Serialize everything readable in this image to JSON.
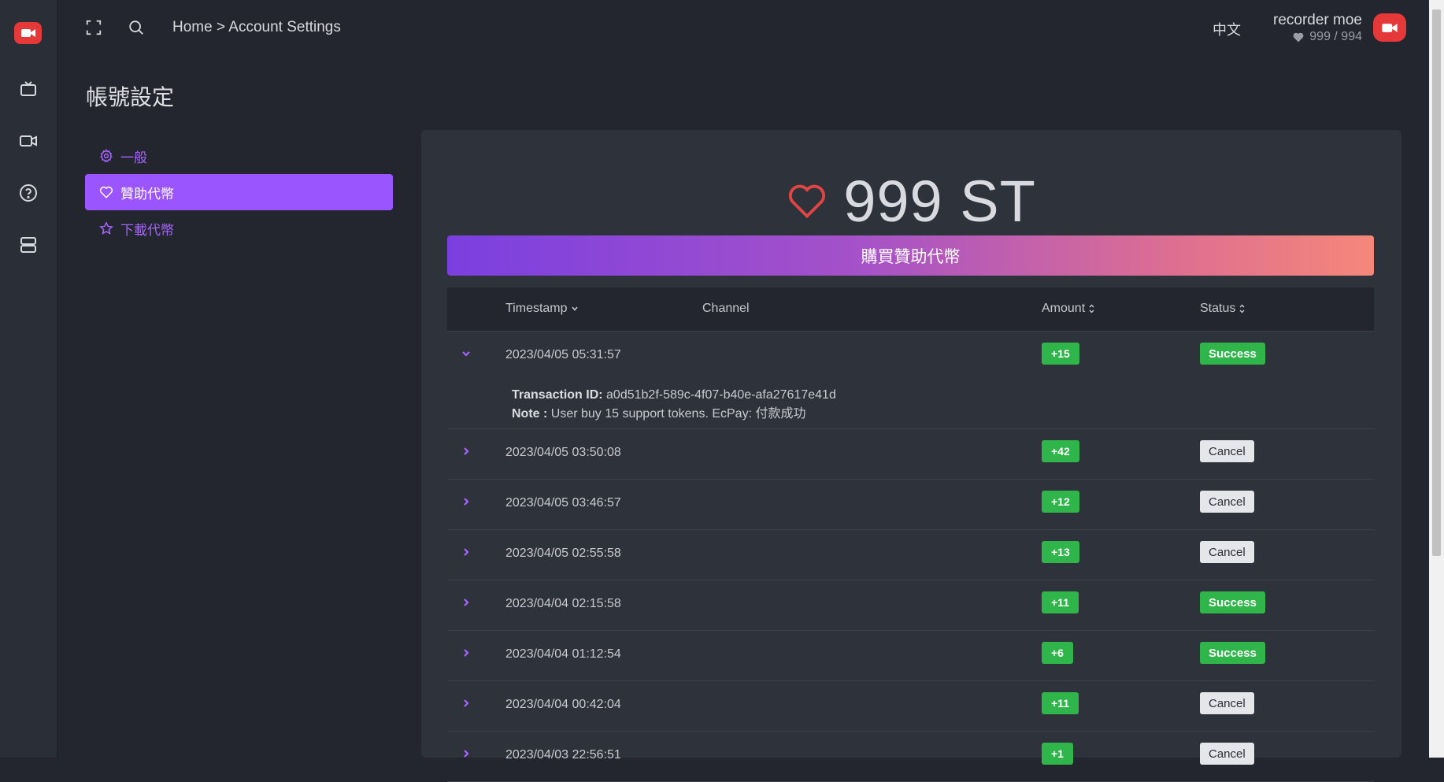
{
  "topbar": {
    "breadcrumb": "Home > Account Settings",
    "language": "中文",
    "user_name": "recorder moe",
    "user_tokens": "999 / 994"
  },
  "page": {
    "title": "帳號設定"
  },
  "side_menu": {
    "items": [
      {
        "label": "一般",
        "icon": "gear-icon"
      },
      {
        "label": "贊助代幣",
        "icon": "heart-icon",
        "active": true
      },
      {
        "label": "下載代幣",
        "icon": "star-icon"
      }
    ]
  },
  "balance": {
    "amount": "999 ST"
  },
  "buy_button": {
    "label": "購買贊助代幣"
  },
  "table": {
    "columns": [
      "Timestamp",
      "Channel",
      "Amount",
      "Status"
    ],
    "rows": [
      {
        "timestamp": "2023/04/05 05:31:57",
        "amount": "+15",
        "status": "Success",
        "expanded": true,
        "detail": {
          "txid_label": "Transaction ID:",
          "txid": "a0d51b2f-589c-4f07-b40e-afa27617e41d",
          "note_label": "Note :",
          "note": "User buy 15 support tokens. EcPay: 付款成功"
        }
      },
      {
        "timestamp": "2023/04/05 03:50:08",
        "amount": "+42",
        "status": "Cancel"
      },
      {
        "timestamp": "2023/04/05 03:46:57",
        "amount": "+12",
        "status": "Cancel"
      },
      {
        "timestamp": "2023/04/05 02:55:58",
        "amount": "+13",
        "status": "Cancel"
      },
      {
        "timestamp": "2023/04/04 02:15:58",
        "amount": "+11",
        "status": "Success"
      },
      {
        "timestamp": "2023/04/04 01:12:54",
        "amount": "+6",
        "status": "Success"
      },
      {
        "timestamp": "2023/04/04 00:42:04",
        "amount": "+11",
        "status": "Cancel"
      },
      {
        "timestamp": "2023/04/03 22:56:51",
        "amount": "+1",
        "status": "Cancel"
      }
    ]
  },
  "colors": {
    "accent": "#9b55ff",
    "brand_red": "#e53838",
    "success_green": "#2fb54a",
    "background": "#23262e",
    "card": "#2e323b"
  }
}
